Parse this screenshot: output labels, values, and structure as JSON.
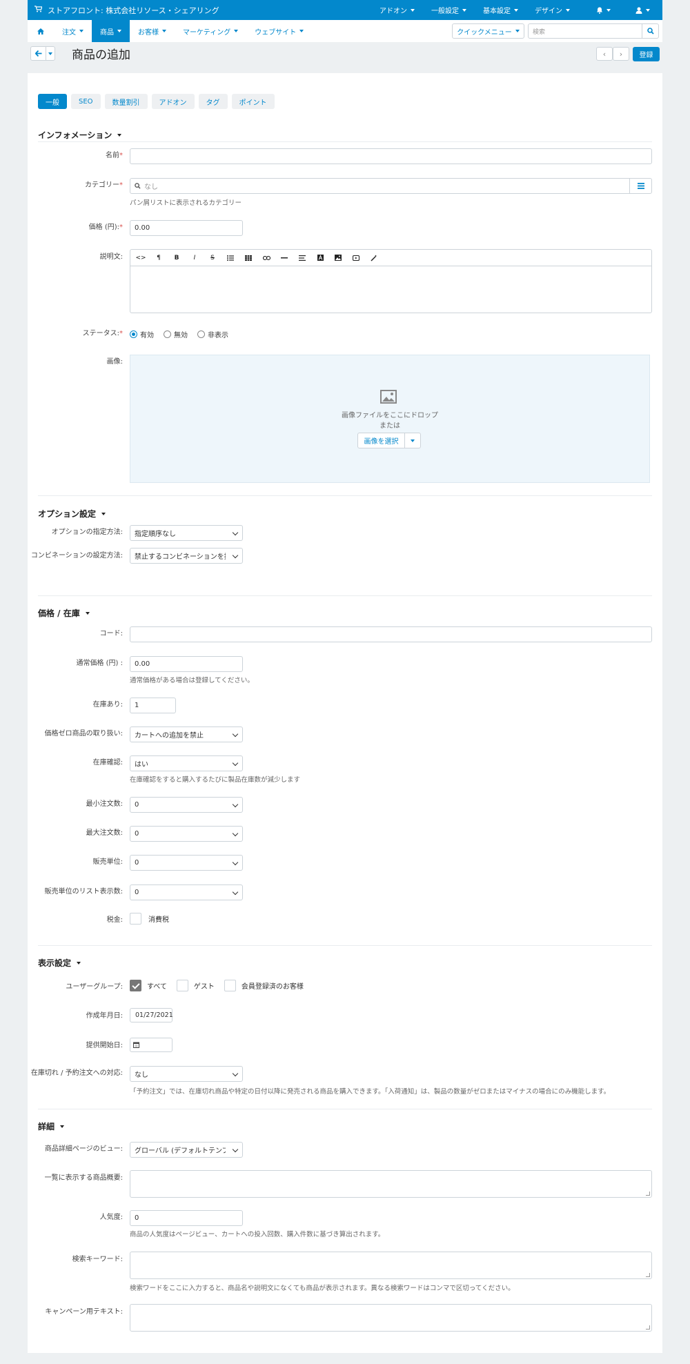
{
  "topbar": {
    "store_name": "ストアフロント: 株式会社リソース・シェアリング",
    "items": [
      "アドオン",
      "一般設定",
      "基本設定",
      "デザイン"
    ]
  },
  "nav": {
    "items": [
      "注文",
      "商品",
      "お客様",
      "マーケティング",
      "ウェブサイト"
    ],
    "quick_menu": "クイックメニュー",
    "search_placeholder": "検索"
  },
  "page": {
    "title": "商品の追加",
    "save": "登録"
  },
  "tabs": [
    "一般",
    "SEO",
    "数量割引",
    "アドオン",
    "タグ",
    "ポイント"
  ],
  "info": {
    "heading": "インフォメーション",
    "name_label": "名前",
    "category_label": "カテゴリー",
    "category_placeholder": "なし",
    "category_hint": "パン屑リストに表示されるカテゴリー",
    "price_label": "価格 (円):",
    "price_value": "0.00",
    "desc_label": "説明文:",
    "status_label": "ステータス:",
    "status_options": [
      "有効",
      "無効",
      "非表示"
    ],
    "image_label": "画像:",
    "drop_text": "画像ファイルをここにドロップ",
    "or_text": "または",
    "choose_image": "画像を選択"
  },
  "options": {
    "heading": "オプション設定",
    "method_label": "オプションの指定方法:",
    "method_value": "指定順序なし",
    "combo_label": "コンビネーションの設定方法:",
    "combo_value": "禁止するコンビネーションを指定"
  },
  "stock": {
    "heading": "価格 / 在庫",
    "code_label": "コード:",
    "list_price_label": "通常価格 (円) :",
    "list_price_value": "0.00",
    "list_price_hint": "通常価格がある場合は登録してください。",
    "in_stock_label": "在庫あり:",
    "in_stock_value": "1",
    "zero_price_label": "価格ゼロ商品の取り扱い:",
    "zero_price_value": "カートへの追加を禁止",
    "track_label": "在庫確認:",
    "track_value": "はい",
    "track_hint": "在庫確認をすると購入するたびに製品在庫数が減少します",
    "min_qty_label": "最小注文数:",
    "min_qty_value": "0",
    "max_qty_label": "最大注文数:",
    "max_qty_value": "0",
    "step_label": "販売単位:",
    "step_value": "0",
    "list_qty_label": "販売単位のリスト表示数:",
    "list_qty_value": "0",
    "tax_label": "税金:",
    "tax_option": "消費税"
  },
  "display": {
    "heading": "表示設定",
    "usergroup_label": "ユーザーグループ:",
    "usergroups": [
      "すべて",
      "ゲスト",
      "会員登録済のお客様"
    ],
    "created_label": "作成年月日:",
    "created_value": "01/27/2021",
    "avail_label": "提供開始日:",
    "avail_value": "",
    "oos_label": "在庫切れ / 予約注文への対応:",
    "oos_value": "なし",
    "oos_hint": "「予約注文」では、在庫切れ商品や特定の日付以降に発売される商品を購入できます。「入荷通知」は、製品の数量がゼロまたはマイナスの場合にのみ機能します。"
  },
  "details": {
    "heading": "詳細",
    "view_label": "商品詳細ページのビュー:",
    "view_value": "グローバル (デフォルトテンプレート)",
    "short_desc_label": "一覧に表示する商品概要:",
    "popularity_label": "人気度:",
    "popularity_value": "0",
    "popularity_hint": "商品の人気度はページビュー、カートへの投入回数、購入件数に基づき算出されます。",
    "keywords_label": "検索キーワード:",
    "keywords_hint": "検索ワードをここに入力すると、商品名や説明文になくても商品が表示されます。異なる検索ワードはコンマで区切ってください。",
    "promo_label": "キャンペーン用テキスト:"
  }
}
